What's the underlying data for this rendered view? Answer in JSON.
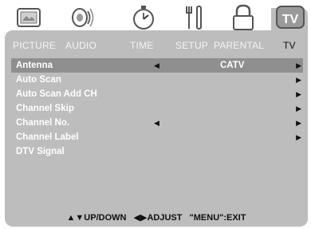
{
  "icons": [
    "picture-icon",
    "audio-icon",
    "time-icon",
    "setup-icon",
    "parental-lock-icon",
    "tv-icon"
  ],
  "tabs": [
    {
      "label": "PICTURE",
      "active": false
    },
    {
      "label": "AUDIO",
      "active": false
    },
    {
      "label": "TIME",
      "active": false
    },
    {
      "label": "SETUP",
      "active": false
    },
    {
      "label": "PARENTAL",
      "active": false
    },
    {
      "label": "TV",
      "active": true
    }
  ],
  "menu": {
    "items": [
      {
        "label": "Antenna",
        "left_arrow": "◀",
        "value": "CATV",
        "right_arrow": "▶",
        "selected": true
      },
      {
        "label": "Auto Scan",
        "left_arrow": "",
        "value": "",
        "right_arrow": "▶",
        "selected": false
      },
      {
        "label": "Auto Scan Add CH",
        "left_arrow": "",
        "value": "",
        "right_arrow": "▶",
        "selected": false
      },
      {
        "label": "Channel Skip",
        "left_arrow": "",
        "value": "",
        "right_arrow": "▶",
        "selected": false
      },
      {
        "label": "Channel No.",
        "left_arrow": "◀",
        "value": "",
        "right_arrow": "▶",
        "selected": false
      },
      {
        "label": "Channel Label",
        "left_arrow": "",
        "value": "",
        "right_arrow": "▶",
        "selected": false
      },
      {
        "label": "DTV Signal",
        "left_arrow": "",
        "value": "",
        "right_arrow": "",
        "selected": false
      }
    ]
  },
  "footer": {
    "updown": "▲▼UP/DOWN",
    "adjust": "◀▶ADJUST",
    "exit": "\"MENU\":EXIT"
  },
  "colors": {
    "panel": "#bdbdbd",
    "selected_row": "#8f8f8f",
    "text_light": "#ffffff",
    "text_dark": "#111111"
  }
}
